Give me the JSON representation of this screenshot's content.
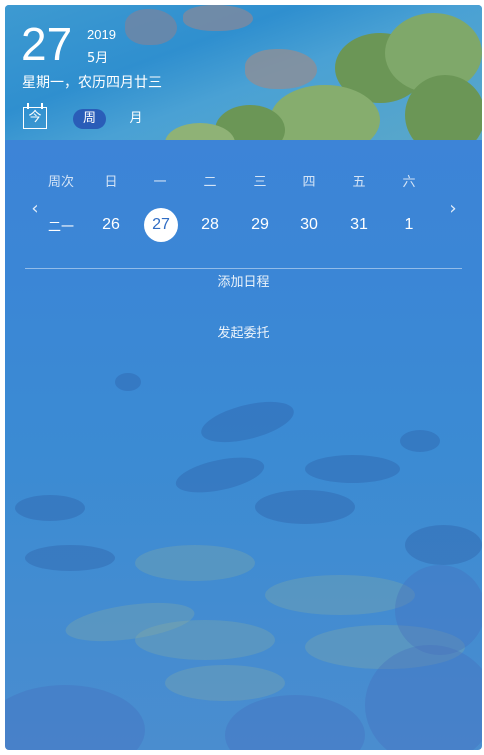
{
  "header": {
    "day": "27",
    "year": "2019",
    "month": "5月",
    "lunar": "星期一，农历四月廿三",
    "today_label": "今",
    "week_label": "周",
    "month_label": "月"
  },
  "calendar": {
    "week_number_header": "周次",
    "weekdays": [
      "日",
      "一",
      "二",
      "三",
      "四",
      "五",
      "六"
    ],
    "week_number": "二一",
    "days": [
      "26",
      "27",
      "28",
      "29",
      "30",
      "31",
      "1"
    ],
    "selected_day": "27"
  },
  "actions": {
    "add_schedule": "添加日程",
    "delegate": "发起委托"
  },
  "colors": {
    "accent": "#2a5db8",
    "background": "#3b86d6",
    "text": "#ffffff"
  },
  "icons": {
    "prev": "chevron-left-icon",
    "next": "chevron-right-icon"
  }
}
